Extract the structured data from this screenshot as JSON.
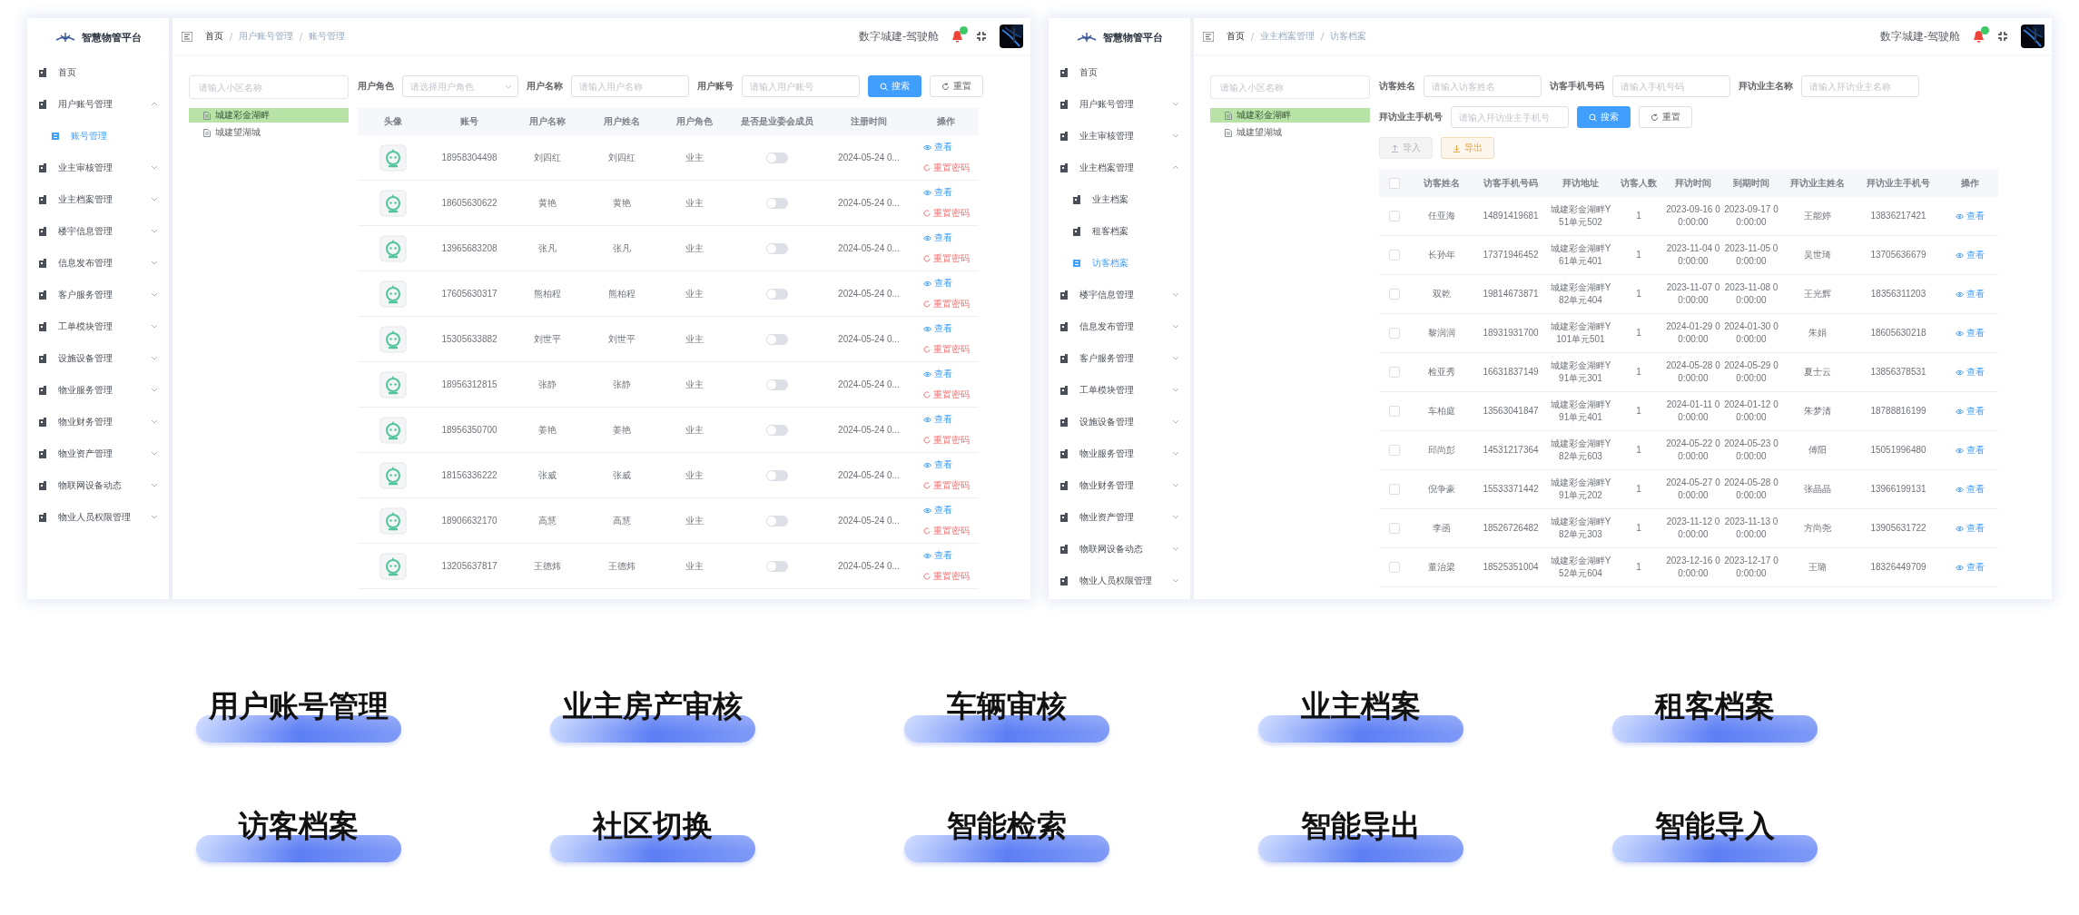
{
  "screens": [
    {
      "logo": "智慧物管平台",
      "sidebar": [
        {
          "label": "首页",
          "selected": false
        },
        {
          "label": "用户账号管理",
          "selected": false,
          "expanded": true,
          "children": [
            {
              "label": "账号管理",
              "selected": true
            }
          ]
        },
        {
          "label": "业主审核管理",
          "selected": false,
          "expanded": false
        },
        {
          "label": "业主档案管理",
          "selected": false,
          "expanded": false
        },
        {
          "label": "楼宇信息管理",
          "selected": false,
          "expanded": false
        },
        {
          "label": "信息发布管理",
          "selected": false,
          "expanded": false
        },
        {
          "label": "客户服务管理",
          "selected": false,
          "expanded": false
        },
        {
          "label": "工单模块管理",
          "selected": false,
          "expanded": false
        },
        {
          "label": "设施设备管理",
          "selected": false,
          "expanded": false
        },
        {
          "label": "物业服务管理",
          "selected": false,
          "expanded": false
        },
        {
          "label": "物业财务管理",
          "selected": false,
          "expanded": false
        },
        {
          "label": "物业资产管理",
          "selected": false,
          "expanded": false
        },
        {
          "label": "物联网设备动态",
          "selected": false,
          "expanded": false
        },
        {
          "label": "物业人员权限管理",
          "selected": false,
          "expanded": false
        }
      ],
      "breadcrumb": [
        "首页",
        "用户账号管理",
        "账号管理"
      ],
      "header_title": "数字城建-驾驶舱",
      "tree": {
        "placeholder": "请输入小区名称",
        "nodes": [
          {
            "label": "城建彩金湖畔",
            "selected": true
          },
          {
            "label": "城建望湖城",
            "selected": false
          }
        ]
      },
      "filter_rows": [
        [
          {
            "label": "用户角色",
            "placeholder": "请选择用户角色",
            "kind": "select"
          },
          {
            "label": "用户名称",
            "placeholder": "请输入用户名称",
            "kind": "input"
          },
          {
            "label": "用户账号",
            "placeholder": "请输入用户账号",
            "kind": "input"
          },
          {
            "label": "搜索",
            "kind": "search"
          },
          {
            "label": "重置",
            "kind": "reset"
          }
        ]
      ],
      "table": {
        "columns": [
          "头像",
          "账号",
          "用户名称",
          "用户姓名",
          "用户角色",
          "是否是业委会成员",
          "注册时间",
          "操作"
        ],
        "rows": [
          {
            "cells": [
              {
                "kind": "avatar"
              },
              "18958304498",
              "刘四红",
              "刘四红",
              "业主",
              {
                "kind": "toggle",
                "on": false
              },
              "2024-05-24 0...",
              {
                "kind": "actions",
                "actions": [
                  {
                    "label": "查看",
                    "kind": "view"
                  },
                  {
                    "label": "重置密码",
                    "kind": "reset"
                  }
                ]
              }
            ]
          },
          {
            "cells": [
              {
                "kind": "avatar"
              },
              "18605630622",
              "黄艳",
              "黄艳",
              "业主",
              {
                "kind": "toggle",
                "on": false
              },
              "2024-05-24 0...",
              {
                "kind": "actions",
                "actions": [
                  {
                    "label": "查看",
                    "kind": "view"
                  },
                  {
                    "label": "重置密码",
                    "kind": "reset"
                  }
                ]
              }
            ]
          },
          {
            "cells": [
              {
                "kind": "avatar"
              },
              "13965683208",
              "张凡",
              "张凡",
              "业主",
              {
                "kind": "toggle",
                "on": false
              },
              "2024-05-24 0...",
              {
                "kind": "actions",
                "actions": [
                  {
                    "label": "查看",
                    "kind": "view"
                  },
                  {
                    "label": "重置密码",
                    "kind": "reset"
                  }
                ]
              }
            ]
          },
          {
            "cells": [
              {
                "kind": "avatar"
              },
              "17605630317",
              "熊柏程",
              "熊柏程",
              "业主",
              {
                "kind": "toggle",
                "on": false
              },
              "2024-05-24 0...",
              {
                "kind": "actions",
                "actions": [
                  {
                    "label": "查看",
                    "kind": "view"
                  },
                  {
                    "label": "重置密码",
                    "kind": "reset"
                  }
                ]
              }
            ]
          },
          {
            "cells": [
              {
                "kind": "avatar"
              },
              "15305633882",
              "刘世平",
              "刘世平",
              "业主",
              {
                "kind": "toggle",
                "on": false
              },
              "2024-05-24 0...",
              {
                "kind": "actions",
                "actions": [
                  {
                    "label": "查看",
                    "kind": "view"
                  },
                  {
                    "label": "重置密码",
                    "kind": "reset"
                  }
                ]
              }
            ]
          },
          {
            "cells": [
              {
                "kind": "avatar"
              },
              "18956312815",
              "张静",
              "张静",
              "业主",
              {
                "kind": "toggle",
                "on": false
              },
              "2024-05-24 0...",
              {
                "kind": "actions",
                "actions": [
                  {
                    "label": "查看",
                    "kind": "view"
                  },
                  {
                    "label": "重置密码",
                    "kind": "reset"
                  }
                ]
              }
            ]
          },
          {
            "cells": [
              {
                "kind": "avatar"
              },
              "18956350700",
              "姜艳",
              "姜艳",
              "业主",
              {
                "kind": "toggle",
                "on": false
              },
              "2024-05-24 0...",
              {
                "kind": "actions",
                "actions": [
                  {
                    "label": "查看",
                    "kind": "view"
                  },
                  {
                    "label": "重置密码",
                    "kind": "reset"
                  }
                ]
              }
            ]
          },
          {
            "cells": [
              {
                "kind": "avatar"
              },
              "18156336222",
              "张威",
              "张威",
              "业主",
              {
                "kind": "toggle",
                "on": false
              },
              "2024-05-24 0...",
              {
                "kind": "actions",
                "actions": [
                  {
                    "label": "查看",
                    "kind": "view"
                  },
                  {
                    "label": "重置密码",
                    "kind": "reset"
                  }
                ]
              }
            ]
          },
          {
            "cells": [
              {
                "kind": "avatar"
              },
              "18906632170",
              "高慧",
              "高慧",
              "业主",
              {
                "kind": "toggle",
                "on": false
              },
              "2024-05-24 0...",
              {
                "kind": "actions",
                "actions": [
                  {
                    "label": "查看",
                    "kind": "view"
                  },
                  {
                    "label": "重置密码",
                    "kind": "reset"
                  }
                ]
              }
            ]
          },
          {
            "cells": [
              {
                "kind": "avatar"
              },
              "13205637817",
              "王德炜",
              "王德炜",
              "业主",
              {
                "kind": "toggle",
                "on": false
              },
              "2024-05-24 0...",
              {
                "kind": "actions",
                "actions": [
                  {
                    "label": "查看",
                    "kind": "view"
                  },
                  {
                    "label": "重置密码",
                    "kind": "reset"
                  }
                ]
              }
            ]
          }
        ]
      }
    },
    {
      "logo": "智慧物管平台",
      "sidebar": [
        {
          "label": "首页",
          "selected": false
        },
        {
          "label": "用户账号管理",
          "selected": false,
          "expanded": false
        },
        {
          "label": "业主审核管理",
          "selected": false,
          "expanded": false
        },
        {
          "label": "业主档案管理",
          "selected": false,
          "expanded": true,
          "children": [
            {
              "label": "业主档案",
              "selected": false
            },
            {
              "label": "租客档案",
              "selected": false
            },
            {
              "label": "访客档案",
              "selected": true
            }
          ]
        },
        {
          "label": "楼宇信息管理",
          "selected": false,
          "expanded": false
        },
        {
          "label": "信息发布管理",
          "selected": false,
          "expanded": false
        },
        {
          "label": "客户服务管理",
          "selected": false,
          "expanded": false
        },
        {
          "label": "工单模块管理",
          "selected": false,
          "expanded": false
        },
        {
          "label": "设施设备管理",
          "selected": false,
          "expanded": false
        },
        {
          "label": "物业服务管理",
          "selected": false,
          "expanded": false
        },
        {
          "label": "物业财务管理",
          "selected": false,
          "expanded": false
        },
        {
          "label": "物业资产管理",
          "selected": false,
          "expanded": false
        },
        {
          "label": "物联网设备动态",
          "selected": false,
          "expanded": false
        },
        {
          "label": "物业人员权限管理",
          "selected": false,
          "expanded": false
        }
      ],
      "breadcrumb": [
        "首页",
        "业主档案管理",
        "访客档案"
      ],
      "header_title": "数字城建-驾驶舱",
      "tree": {
        "placeholder": "请输入小区名称",
        "nodes": [
          {
            "label": "城建彩金湖畔",
            "selected": true
          },
          {
            "label": "城建望湖城",
            "selected": false
          }
        ]
      },
      "filter_rows": [
        [
          {
            "label": "访客姓名",
            "placeholder": "请输入访客姓名",
            "kind": "input"
          },
          {
            "label": "访客手机号码",
            "placeholder": "请输入手机号码",
            "kind": "input"
          },
          {
            "label": "拜访业主名称",
            "placeholder": "请输入拜访业主名称",
            "kind": "input"
          }
        ],
        [
          {
            "label": "拜访业主手机号",
            "placeholder": "请输入拜访业主手机号",
            "kind": "input"
          },
          {
            "label": "搜索",
            "kind": "search"
          },
          {
            "label": "重置",
            "kind": "reset"
          }
        ],
        [
          {
            "label": "导入",
            "kind": "import"
          },
          {
            "label": "导出",
            "kind": "export"
          }
        ]
      ],
      "table": {
        "columns": [
          {
            "kind": "checkbox",
            "checked": false
          },
          "访客姓名",
          "访客手机号码",
          "拜访地址",
          "访客人数",
          "拜访时间",
          "到期时间",
          "拜访业主姓名",
          "拜访业主手机号",
          "操作"
        ],
        "rows": [
          {
            "cells": [
              {
                "kind": "checkbox",
                "checked": false
              },
              "任亚海",
              "14891419681",
              "城建彩金湖畔Y51单元502",
              "1",
              "2023-09-16 00:00:00",
              "2023-09-17 00:00:00",
              "王能婷",
              "13836217421",
              {
                "kind": "actions",
                "actions": [
                  {
                    "label": "查看",
                    "kind": "view"
                  }
                ]
              }
            ]
          },
          {
            "cells": [
              {
                "kind": "checkbox",
                "checked": false
              },
              "长孙年",
              "17371946452",
              "城建彩金湖畔Y61单元401",
              "1",
              "2023-11-04 00:00:00",
              "2023-11-05 00:00:00",
              "吴世琦",
              "13705636679",
              {
                "kind": "actions",
                "actions": [
                  {
                    "label": "查看",
                    "kind": "view"
                  }
                ]
              }
            ]
          },
          {
            "cells": [
              {
                "kind": "checkbox",
                "checked": false
              },
              "双乾",
              "19814673871",
              "城建彩金湖畔Y82单元404",
              "1",
              "2023-11-07 00:00:00",
              "2023-11-08 00:00:00",
              "王光辉",
              "18356311203",
              {
                "kind": "actions",
                "actions": [
                  {
                    "label": "查看",
                    "kind": "view"
                  }
                ]
              }
            ]
          },
          {
            "cells": [
              {
                "kind": "checkbox",
                "checked": false
              },
              "黎润润",
              "18931931700",
              "城建彩金湖畔Y101单元501",
              "1",
              "2024-01-29 00:00:00",
              "2024-01-30 00:00:00",
              "朱娟",
              "18605630218",
              {
                "kind": "actions",
                "actions": [
                  {
                    "label": "查看",
                    "kind": "view"
                  }
                ]
              }
            ]
          },
          {
            "cells": [
              {
                "kind": "checkbox",
                "checked": false
              },
              "检亚秀",
              "16631837149",
              "城建彩金湖畔Y91单元301",
              "1",
              "2024-05-28 00:00:00",
              "2024-05-29 00:00:00",
              "夏士云",
              "13856378531",
              {
                "kind": "actions",
                "actions": [
                  {
                    "label": "查看",
                    "kind": "view"
                  }
                ]
              }
            ]
          },
          {
            "cells": [
              {
                "kind": "checkbox",
                "checked": false
              },
              "车柏庭",
              "13563041847",
              "城建彩金湖畔Y91单元401",
              "1",
              "2024-01-11 00:00:00",
              "2024-01-12 00:00:00",
              "朱梦清",
              "18788816199",
              {
                "kind": "actions",
                "actions": [
                  {
                    "label": "查看",
                    "kind": "view"
                  }
                ]
              }
            ]
          },
          {
            "cells": [
              {
                "kind": "checkbox",
                "checked": false
              },
              "邱尚彭",
              "14531217364",
              "城建彩金湖畔Y82单元603",
              "1",
              "2024-05-22 00:00:00",
              "2024-05-23 00:00:00",
              "傅阳",
              "15051996480",
              {
                "kind": "actions",
                "actions": [
                  {
                    "label": "查看",
                    "kind": "view"
                  }
                ]
              }
            ]
          },
          {
            "cells": [
              {
                "kind": "checkbox",
                "checked": false
              },
              "倪争豪",
              "15533371442",
              "城建彩金湖畔Y91单元202",
              "1",
              "2024-05-27 00:00:00",
              "2024-05-28 00:00:00",
              "张晶晶",
              "13966199131",
              {
                "kind": "actions",
                "actions": [
                  {
                    "label": "查看",
                    "kind": "view"
                  }
                ]
              }
            ]
          },
          {
            "cells": [
              {
                "kind": "checkbox",
                "checked": false
              },
              "李函",
              "18526726482",
              "城建彩金湖畔Y82单元303",
              "1",
              "2023-11-12 00:00:00",
              "2023-11-13 00:00:00",
              "方尚尧",
              "13905631722",
              {
                "kind": "actions",
                "actions": [
                  {
                    "label": "查看",
                    "kind": "view"
                  }
                ]
              }
            ]
          },
          {
            "cells": [
              {
                "kind": "checkbox",
                "checked": false
              },
              "董治梁",
              "18525351004",
              "城建彩金湖畔Y52单元604",
              "1",
              "2023-12-16 00:00:00",
              "2023-12-17 00:00:00",
              "王璐",
              "18326449709",
              {
                "kind": "actions",
                "actions": [
                  {
                    "label": "查看",
                    "kind": "view"
                  }
                ]
              }
            ]
          }
        ]
      }
    }
  ],
  "features": [
    "用户账号管理",
    "业主房产审核",
    "车辆审核",
    "业主档案",
    "租客档案",
    "访客档案",
    "社区切换",
    "智能检索",
    "智能导出",
    "智能导入"
  ]
}
